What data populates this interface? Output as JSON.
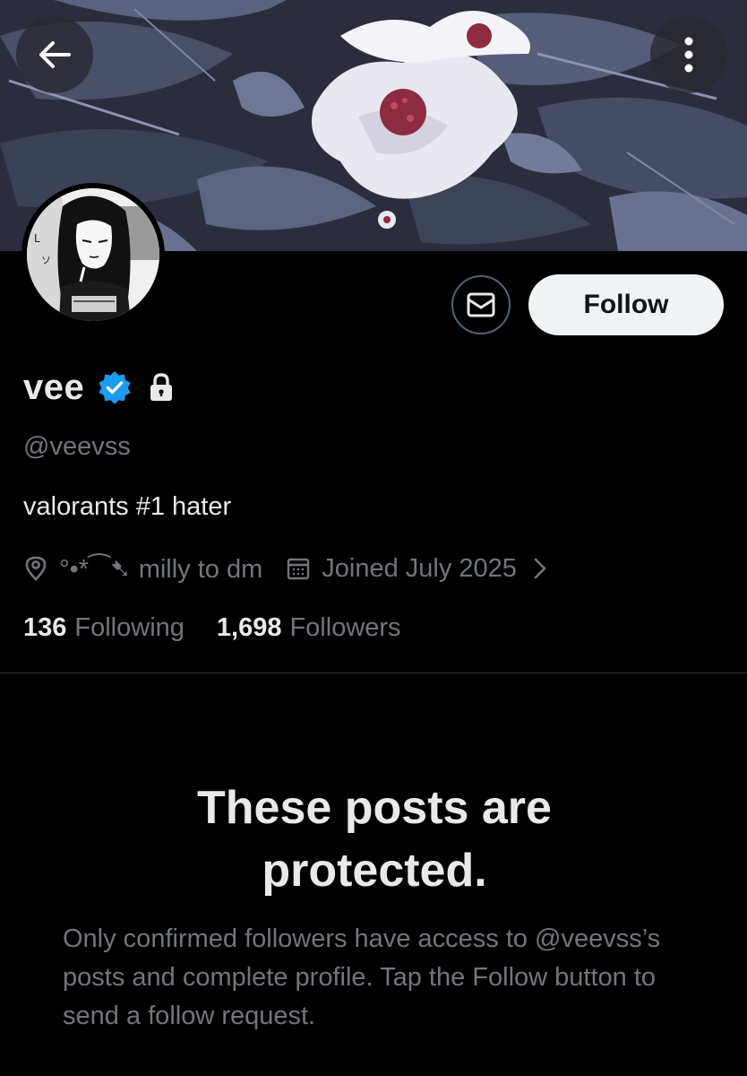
{
  "header": {
    "back_icon": "arrow-left-icon",
    "more_icon": "more-vertical-icon"
  },
  "profile": {
    "display_name": "vee",
    "handle": "@veevss",
    "bio": "valorants #1 hater",
    "location": "°•*⁀➷ milly to dm",
    "joined": "Joined July 2025",
    "verified": true,
    "protected": true
  },
  "actions": {
    "message_icon": "envelope-icon",
    "follow_label": "Follow"
  },
  "stats": {
    "following_count": "136",
    "following_label": "Following",
    "followers_count": "1,698",
    "followers_label": "Followers"
  },
  "protected_notice": {
    "title": "These posts are protected.",
    "body": "Only confirmed followers have access to @veevss’s posts and complete profile. Tap the Follow button to send a follow request."
  },
  "colors": {
    "background": "#000000",
    "primary_text": "#e7e9ea",
    "secondary_text": "#71767b",
    "verified_blue": "#1d9bf0",
    "follow_button_bg": "#eff3f4",
    "divider": "#2f3336"
  }
}
